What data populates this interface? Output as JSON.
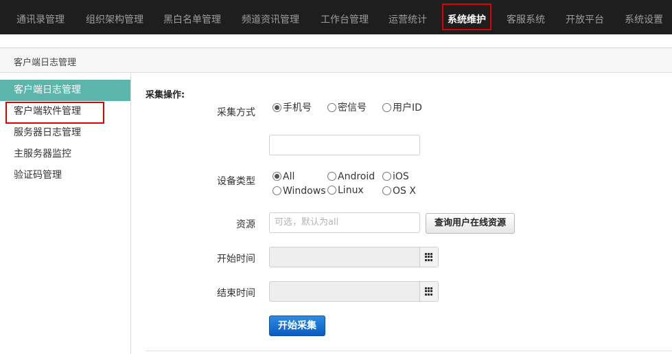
{
  "nav": {
    "items": [
      {
        "label": "通讯录管理"
      },
      {
        "label": "组织架构管理"
      },
      {
        "label": "黑白名单管理"
      },
      {
        "label": "频道资讯管理"
      },
      {
        "label": "工作台管理"
      },
      {
        "label": "运营统计"
      },
      {
        "label": "系统维护",
        "active": true
      },
      {
        "label": "客服系统"
      },
      {
        "label": "开放平台"
      },
      {
        "label": "系统设置"
      }
    ]
  },
  "page": {
    "title": "客户端日志管理"
  },
  "sidebar": {
    "items": [
      {
        "label": "客户端日志管理",
        "active": true
      },
      {
        "label": "客户端软件管理"
      },
      {
        "label": "服务器日志管理"
      },
      {
        "label": "主服务器监控"
      },
      {
        "label": "验证码管理"
      }
    ]
  },
  "form": {
    "section_label": "采集操作:",
    "collect_method": {
      "label": "采集方式",
      "options": [
        "手机号",
        "密信号",
        "用户ID"
      ],
      "selected": "手机号",
      "input_value": ""
    },
    "device_type": {
      "label": "设备类型",
      "options": [
        "All",
        "Android",
        "iOS",
        "Windows",
        "Linux",
        "OS X"
      ],
      "selected": "All"
    },
    "resource": {
      "label": "资源",
      "placeholder": "可选，默认为all",
      "query_button": "查询用户在线资源"
    },
    "start_time": {
      "label": "开始时间",
      "value": ""
    },
    "end_time": {
      "label": "结束时间",
      "value": ""
    },
    "start_button": "开始采集"
  },
  "colors": {
    "nav_bg": "#1e1e1e",
    "sidebar_active": "#5bb5ab",
    "primary_button": "#1565c8",
    "highlight_box": "#e00000"
  }
}
